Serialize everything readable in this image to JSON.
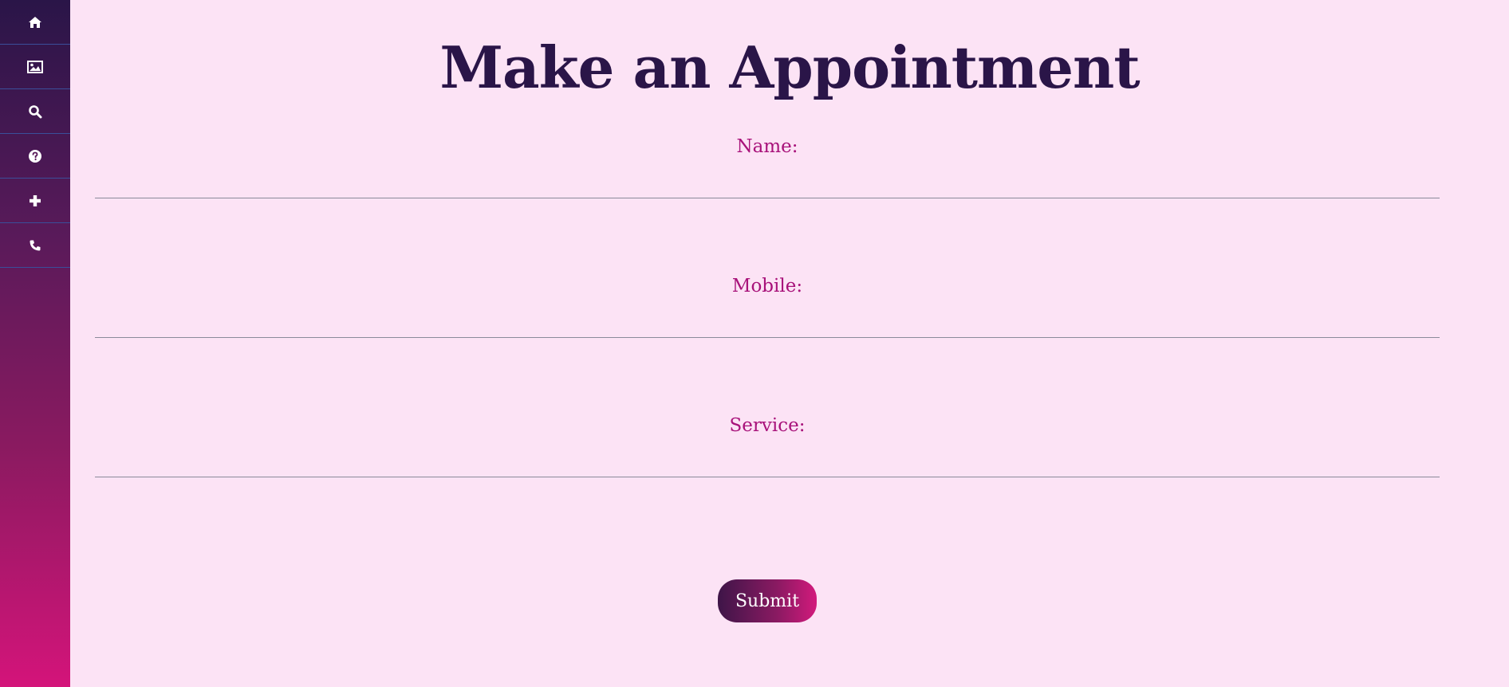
{
  "sidebar": {
    "items": [
      {
        "icon": "home-icon"
      },
      {
        "icon": "image-icon"
      },
      {
        "icon": "search-icon"
      },
      {
        "icon": "help-icon"
      },
      {
        "icon": "plus-icon"
      },
      {
        "icon": "phone-icon"
      }
    ],
    "colors": {
      "top": "#2a1548",
      "bottom": "#d4147a",
      "divider": "#3a4f9a"
    }
  },
  "page": {
    "title": "Make an Appointment"
  },
  "form": {
    "name_label": "Name:",
    "name_value": "",
    "mobile_label": "Mobile:",
    "mobile_value": "",
    "service_label": "Service:",
    "service_value": "",
    "submit_label": "Submit"
  },
  "colors": {
    "background": "#fce3f5",
    "title": "#2a1548",
    "label": "#a8127a"
  }
}
